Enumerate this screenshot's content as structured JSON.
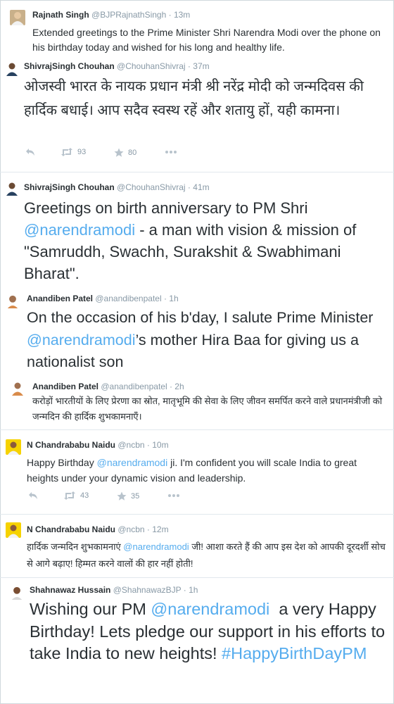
{
  "tweets": [
    {
      "name": "Rajnath Singh",
      "handle": "@BJPRajnathSingh",
      "time": "13m",
      "text": "Extended greetings to the Prime Minister Shri Narendra Modi over the phone on his birthday today and wished for his long and healthy life."
    },
    {
      "name": "ShivrajSingh Chouhan",
      "handle": "@ChouhanShivraj",
      "time": "37m",
      "text": "ओजस्वी भारत के नायक प्रधान मंत्री श्री नरेंद्र मोदी को जन्मदिवस की हार्दिक बधाई। आप सदैव स्वस्थ रहें और शतायु हों, यही कामना।",
      "retweets": "93",
      "favorites": "80"
    },
    {
      "name": "ShivrajSingh Chouhan",
      "handle": "@ChouhanShivraj",
      "time": "41m",
      "text_before": "Greetings on birth anniversary to PM Shri ",
      "mention": "@narendramodi",
      "text_after": " - a man with vision & mission of \"Samruddh, Swachh, Surakshit & Swabhimani Bharat\"."
    },
    {
      "name": "Anandiben Patel",
      "handle": "@anandibenpatel",
      "time": "1h",
      "text_before": "On the occasion of his b'day, I salute Prime Minister ",
      "mention": "@narendramodi",
      "text_after": "’s mother Hira Baa for giving us a nationalist son"
    },
    {
      "name": "Anandiben Patel",
      "handle": "@anandibenpatel",
      "time": "2h",
      "text": "करोड़ों भारतीयों के लिए प्रेरणा का स्रोत, मातृभूमि की सेवा के लिए जीवन समर्पित करने वाले प्रधानमंत्रीजी को जन्मदिन की हार्दिक शुभकामनाएँ।"
    },
    {
      "name": "N Chandrababu Naidu",
      "handle": "@ncbn",
      "time": "10m",
      "text_before": "Happy Birthday ",
      "mention": "@narendramodi",
      "text_after": " ji. I'm confident you will scale India to great heights under your dynamic vision and leadership.",
      "retweets": "43",
      "favorites": "35"
    },
    {
      "name": "N Chandrababu Naidu",
      "handle": "@ncbn",
      "time": "12m",
      "text_before": "हार्दिक जन्मदिन शुभकामनाएं ",
      "mention": "@narendramodi",
      "text_after": " जी! आशा करते हैं की आप इस देश को आपकी दूरदर्शी सोच से आगे बढ़ाए! हिम्मत करने वालों की हार नहीं होती!"
    },
    {
      "name": "Shahnawaz Hussain",
      "handle": "@ShahnawazBJP",
      "time": "1h",
      "text_before": "Wishing our PM ",
      "mention": "@narendramodi",
      "text_after": "  a very Happy Birthday! Lets pledge our support in his efforts to take India to new heights! ",
      "hashtag": "#HappyBirthDayPM"
    }
  ],
  "colors": {
    "link": "#55acee",
    "meta": "#8899a6",
    "text": "#292f33",
    "divider": "#e1e8ed"
  },
  "icons": [
    "reply-icon",
    "retweet-icon",
    "favorite-icon",
    "more-icon"
  ]
}
